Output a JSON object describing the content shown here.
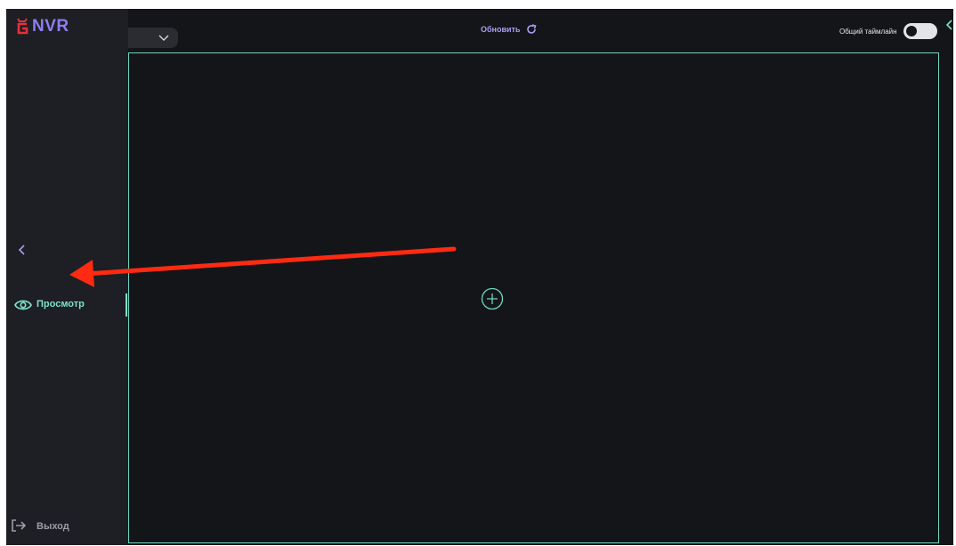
{
  "app": {
    "logo_text": "NVR",
    "logo_icon": "nvr-logo-icon"
  },
  "sidebar": {
    "collapse_icon": "chevron-left-icon",
    "items": [
      {
        "label": "Просмотр",
        "icon": "eye-icon",
        "active": true
      }
    ],
    "logout": {
      "label": "Выход",
      "icon": "logout-icon"
    }
  },
  "header": {
    "select": {
      "icon": "chevron-down-icon"
    },
    "refresh": {
      "label": "Обновить",
      "icon": "refresh-icon"
    },
    "timeline": {
      "label": "Общий таймлайн",
      "enabled": false
    },
    "right_panel_icon": "chevron-left-icon"
  },
  "viewport": {
    "add_icon": "plus-circle-icon"
  },
  "annotation": {
    "type": "arrow",
    "color": "#ff2a12"
  },
  "colors": {
    "accent_teal": "#7ee0c8",
    "accent_purple": "#a99cf3",
    "logo_red": "#e5303c",
    "background": "#141519",
    "sidebar": "#1d1f24"
  }
}
